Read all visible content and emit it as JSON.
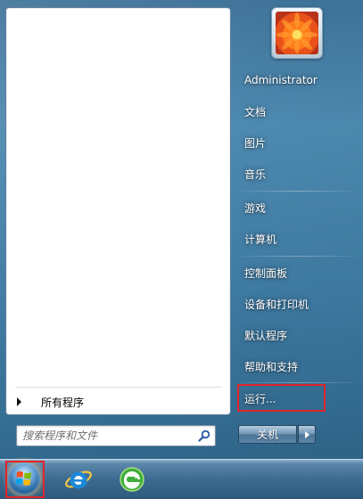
{
  "start_menu": {
    "all_programs": "所有程序",
    "search_placeholder": "搜索程序和文件",
    "user_name": "Administrator",
    "right_items": [
      {
        "label": "文档"
      },
      {
        "label": "图片"
      },
      {
        "label": "音乐"
      },
      {
        "label": "游戏"
      },
      {
        "label": "计算机"
      },
      {
        "label": "控制面板"
      },
      {
        "label": "设备和打印机"
      },
      {
        "label": "默认程序"
      },
      {
        "label": "帮助和支持"
      },
      {
        "label": "运行..."
      }
    ],
    "shutdown_label": "关机"
  },
  "taskbar": {
    "icons": [
      "windows-start-orb-icon",
      "internet-explorer-icon",
      "360-browser-icon"
    ]
  },
  "colors": {
    "highlight": "#e0242a",
    "panel_bg": "#ffffff",
    "glass_bg": "#3d7aa3"
  }
}
